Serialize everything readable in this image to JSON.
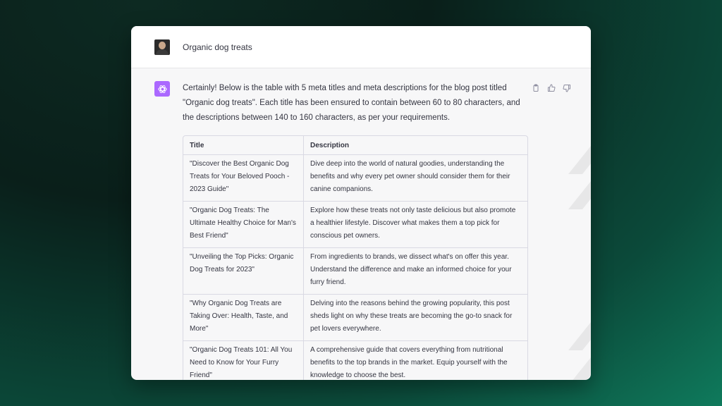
{
  "user": {
    "message": "Organic dog treats"
  },
  "assistant": {
    "intro": "Certainly! Below is the table with 5 meta titles and meta descriptions for the blog post titled \"Organic dog treats\". Each title has been ensured to contain between 60 to 80 characters, and the descriptions between 140 to 160 characters, as per your requirements.",
    "table": {
      "headers": [
        "Title",
        "Description"
      ],
      "rows": [
        [
          "\"Discover the Best Organic Dog Treats for Your Beloved Pooch - 2023 Guide\"",
          "Dive deep into the world of natural goodies, understanding the benefits and why every pet owner should consider them for their canine companions."
        ],
        [
          "\"Organic Dog Treats: The Ultimate Healthy Choice for Man's Best Friend\"",
          "Explore how these treats not only taste delicious but also promote a healthier lifestyle. Discover what makes them a top pick for conscious pet owners."
        ],
        [
          "\"Unveiling the Top Picks: Organic Dog Treats for 2023\"",
          "From ingredients to brands, we dissect what's on offer this year. Understand the difference and make an informed choice for your furry friend."
        ],
        [
          "\"Why Organic Dog Treats are Taking Over: Health, Taste, and More\"",
          "Delving into the reasons behind the growing popularity, this post sheds light on why these treats are becoming the go-to snack for pet lovers everywhere."
        ],
        [
          "\"Organic Dog Treats 101: All You Need to Know for Your Furry Friend\"",
          "A comprehensive guide that covers everything from nutritional benefits to the top brands in the market. Equip yourself with the knowledge to choose the best."
        ]
      ]
    }
  },
  "icons": {
    "copy": "clipboard-icon",
    "like": "thumbs-up-icon",
    "dislike": "thumbs-down-icon",
    "assistant": "openai-logo-icon"
  },
  "colors": {
    "assistant_logo": "#ab68ff",
    "card_bg": "#f7f7f8",
    "text": "#343541"
  }
}
